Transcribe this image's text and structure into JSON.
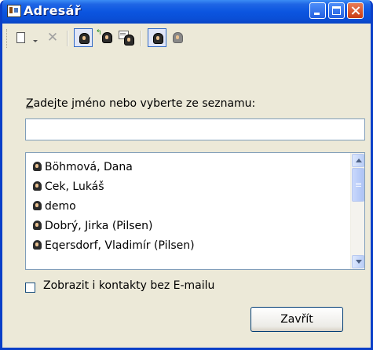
{
  "window": {
    "title": "Adresář"
  },
  "toolbar": {
    "buttons": [
      {
        "icon": "new-page-icon"
      },
      {
        "icon": "dropdown-arrow-icon"
      },
      {
        "icon": "delete-icon"
      },
      {
        "icon": "contact-icon",
        "pressed": true
      },
      {
        "icon": "add-contact-icon"
      },
      {
        "icon": "contact-properties-icon"
      },
      {
        "icon": "contact-icon",
        "pressed": true
      },
      {
        "icon": "contact-group-icon"
      }
    ]
  },
  "prompt": {
    "label_accesskey": "Z",
    "label_rest": "adejte jméno nebo vyberte ze seznamu:"
  },
  "search": {
    "value": ""
  },
  "contacts": [
    {
      "name": "Böhmová, Dana"
    },
    {
      "name": "Cek, Lukáš"
    },
    {
      "name": "demo"
    },
    {
      "name": "Dobrý, Jirka (Pilsen)"
    },
    {
      "name": "Eqersdorf, Vladimír (Pilsen)"
    }
  ],
  "options": {
    "show_without_email_label": "Zobrazit i kontakty bez E-mailu",
    "show_without_email_checked": false
  },
  "actions": {
    "close_label": "Zavřít"
  }
}
